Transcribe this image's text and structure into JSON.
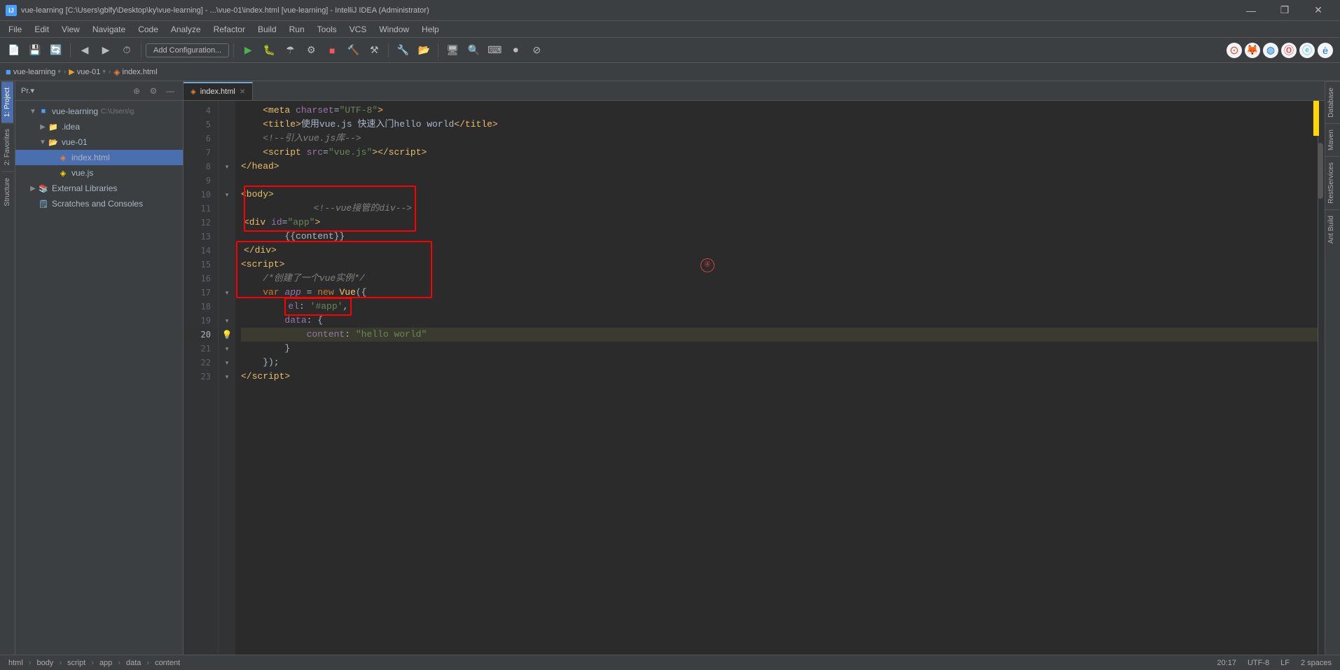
{
  "titleBar": {
    "icon": "IJ",
    "title": "vue-learning [C:\\Users\\gblfy\\Desktop\\ky\\vue-learning] - ...\\vue-01\\index.html [vue-learning] - IntelliJ IDEA (Administrator)",
    "minimizeBtn": "—",
    "maximizeBtn": "❐",
    "closeBtn": "✕"
  },
  "menuBar": {
    "items": [
      "File",
      "Edit",
      "View",
      "Navigate",
      "Code",
      "Analyze",
      "Refactor",
      "Build",
      "Run",
      "Tools",
      "VCS",
      "Window",
      "Help"
    ]
  },
  "toolbar": {
    "addConfig": "Add Configuration...",
    "buttons": [
      "save",
      "save-all",
      "sync",
      "back",
      "forward",
      "recent"
    ]
  },
  "navBar": {
    "projectName": "vue-learning",
    "folder": "vue-01",
    "file": "index.html"
  },
  "sidebar": {
    "title": "Pr.▾",
    "items": [
      {
        "indent": 0,
        "hasArrow": true,
        "arrowOpen": true,
        "icon": "project",
        "label": "vue-learning",
        "suffix": "C:\\Users\\g"
      },
      {
        "indent": 1,
        "hasArrow": true,
        "arrowOpen": false,
        "icon": "folder",
        "label": ".idea"
      },
      {
        "indent": 1,
        "hasArrow": true,
        "arrowOpen": true,
        "icon": "folder",
        "label": "vue-01"
      },
      {
        "indent": 2,
        "hasArrow": false,
        "icon": "html",
        "label": "index.html"
      },
      {
        "indent": 2,
        "hasArrow": false,
        "icon": "js",
        "label": "vue.js"
      },
      {
        "indent": 1,
        "hasArrow": true,
        "arrowOpen": false,
        "icon": "folder",
        "label": "External Libraries"
      },
      {
        "indent": 0,
        "hasArrow": false,
        "icon": "scratch",
        "label": "Scratches and Consoles"
      }
    ]
  },
  "tabs": [
    {
      "label": "index.html",
      "active": true,
      "icon": "html"
    }
  ],
  "code": {
    "lines": [
      {
        "num": 4,
        "gutter": "none",
        "content": "meta_line",
        "highlight": false
      },
      {
        "num": 5,
        "gutter": "none",
        "content": "title_line",
        "highlight": false
      },
      {
        "num": 6,
        "gutter": "none",
        "content": "comment_line",
        "highlight": false
      },
      {
        "num": 7,
        "gutter": "none",
        "content": "script_line",
        "highlight": false
      },
      {
        "num": 8,
        "gutter": "fold",
        "content": "head_close",
        "highlight": false
      },
      {
        "num": 9,
        "gutter": "none",
        "content": "empty",
        "highlight": false
      },
      {
        "num": 10,
        "gutter": "fold",
        "content": "body_open",
        "highlight": false
      },
      {
        "num": 11,
        "gutter": "none",
        "content": "comment2_line",
        "highlight": false
      },
      {
        "num": 12,
        "gutter": "none",
        "content": "div_open",
        "highlight": false
      },
      {
        "num": 13,
        "gutter": "none",
        "content": "template_line",
        "highlight": false
      },
      {
        "num": 14,
        "gutter": "none",
        "content": "div_close",
        "highlight": false
      },
      {
        "num": 15,
        "gutter": "none",
        "content": "script2_open",
        "highlight": false
      },
      {
        "num": 16,
        "gutter": "none",
        "content": "comment3_line",
        "highlight": false
      },
      {
        "num": 17,
        "gutter": "fold",
        "content": "var_line",
        "highlight": false
      },
      {
        "num": 18,
        "gutter": "none",
        "content": "el_line",
        "highlight": false
      },
      {
        "num": 19,
        "gutter": "fold",
        "content": "data_line",
        "highlight": false
      },
      {
        "num": 20,
        "gutter": "bulb",
        "content": "content_line",
        "highlight": true
      },
      {
        "num": 21,
        "gutter": "fold",
        "content": "brace_close",
        "highlight": false
      },
      {
        "num": 22,
        "gutter": "fold",
        "content": "paren_close",
        "highlight": false
      },
      {
        "num": 23,
        "gutter": "fold",
        "content": "script2_close",
        "highlight": false
      }
    ]
  },
  "statusBar": {
    "breadcrumb": [
      "html",
      "body",
      "script",
      "app",
      "data",
      "content"
    ],
    "lineInfo": "20:17",
    "encoding": "UTF-8",
    "lf": "LF",
    "indent": "2 spaces"
  },
  "rightPanels": [
    "Database",
    "Maven",
    "RestServices",
    "Ant Build"
  ],
  "leftPanels": [
    "Project",
    "Favorites",
    "Structure"
  ],
  "circleAnnotation": "④",
  "browserIcons": [
    "chrome",
    "firefox",
    "edge-blue",
    "opera",
    "ie",
    "edge"
  ]
}
